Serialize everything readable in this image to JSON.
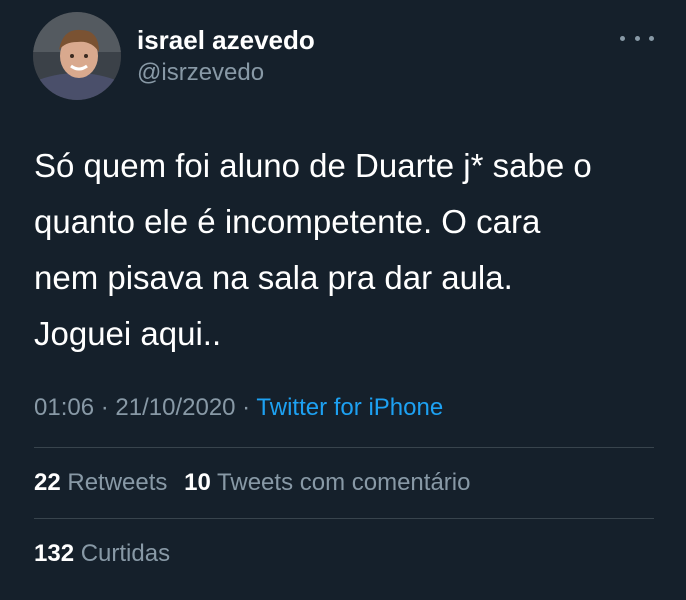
{
  "user": {
    "display_name": "israel azevedo",
    "handle": "@isrzevedo",
    "avatar_icon": "profile-photo"
  },
  "tweet": {
    "lines": [
      "Só quem foi aluno de Duarte j* sabe o",
      "quanto ele é incompetente. O cara",
      "nem pisava na sala pra dar aula.",
      "Joguei aqui.."
    ],
    "time": "01:06",
    "separator": " · ",
    "date": "21/10/2020",
    "source": "Twitter for iPhone"
  },
  "stats": {
    "retweets_count": "22",
    "retweets_label": "Retweets",
    "quotes_count": "10",
    "quotes_label": "Tweets com comentário",
    "likes_count": "132",
    "likes_label": "Curtidas"
  },
  "colors": {
    "background": "#15202b",
    "text": "#ffffff",
    "muted": "#8899a6",
    "link": "#1da1f2",
    "divider": "#38444d"
  },
  "icons": {
    "more": "more-horizontal-icon"
  }
}
